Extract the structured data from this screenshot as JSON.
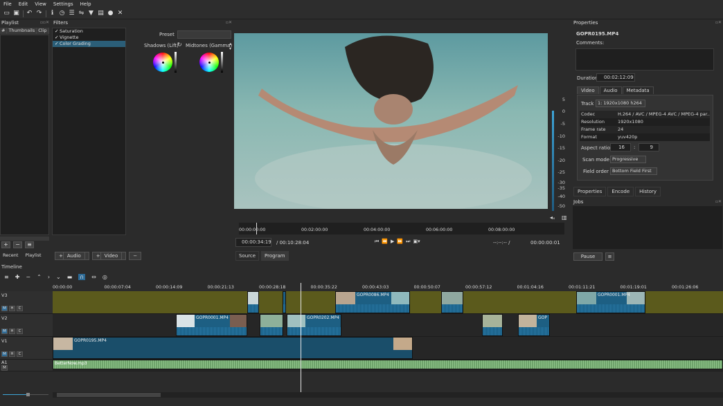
{
  "menu": [
    "File",
    "Edit",
    "View",
    "Settings",
    "Help"
  ],
  "playlist": {
    "title": "Playlist",
    "tabs": [
      "#",
      "Thumbnails",
      "Clip"
    ],
    "bottom_tabs": [
      "Recent",
      "Playlist"
    ]
  },
  "filters": {
    "title": "Filters",
    "items": [
      {
        "label": "Saturation",
        "checked": true,
        "selected": false
      },
      {
        "label": "Vignette",
        "checked": true,
        "selected": false
      },
      {
        "label": "Color Grading",
        "checked": true,
        "selected": true
      }
    ],
    "preset_label": "Preset",
    "shadows_label": "Shadows (Lift)",
    "midtones_label": "Midtones (Gamma)"
  },
  "add_buttons": {
    "audio": "Audio",
    "video": "Video"
  },
  "player": {
    "ruler_ticks": [
      "00:00:00:00",
      "00:02:00:00",
      "00:04:00:00",
      "00:06:00:00",
      "00:08:00:00"
    ],
    "current_tc": "00:00:34:19",
    "duration": "/ 00:10:28:04",
    "in_out": "--:--:-- /",
    "end_tc": "00:00:00:01",
    "tabs": [
      "Source",
      "Program"
    ],
    "vu_labels": [
      "5",
      "0",
      "-5",
      "-10",
      "-15",
      "-20",
      "-25",
      "-30",
      "-35",
      "-40",
      "-50"
    ]
  },
  "properties": {
    "title": "Properties",
    "filename": "GOPR0195.MP4",
    "comments_label": "Comments:",
    "duration_label": "Duration",
    "duration_value": "00:02:12:09",
    "tabs": [
      "Video",
      "Audio",
      "Metadata"
    ],
    "track_label": "Track",
    "track_value": "1: 1920x1080 h264",
    "info": [
      {
        "k": "Codec",
        "v": "H.264 / AVC / MPEG-4 AVC / MPEG-4 par..."
      },
      {
        "k": "Resolution",
        "v": "1920x1080"
      },
      {
        "k": "Frame rate",
        "v": "24"
      },
      {
        "k": "Format",
        "v": "yuv420p"
      }
    ],
    "aspect_label": "Aspect ratio",
    "aspect_a": "16",
    "aspect_sep": ":",
    "aspect_b": "9",
    "scan_label": "Scan mode",
    "scan_value": "Progressive",
    "field_label": "Field order",
    "field_value": "Bottom Field First",
    "bottom_tabs": [
      "Properties",
      "Encode",
      "History"
    ]
  },
  "jobs": {
    "title": "Jobs",
    "pause": "Pause"
  },
  "timeline": {
    "title": "Timeline",
    "ruler": [
      "00:00:00",
      "00:00:07:04",
      "00:00:14:09",
      "00:00:21:13",
      "00:00:28:18",
      "00:00:35:22",
      "00:00:43:03",
      "00:00:50:07",
      "00:00:57:12",
      "00:01:04:16",
      "00:01:11:21",
      "00:01:19:01",
      "00:01:26:06"
    ],
    "tracks": [
      {
        "name": "V3",
        "buttons": [
          "M",
          "H",
          "C"
        ]
      },
      {
        "name": "V2",
        "buttons": [
          "M",
          "H",
          "C"
        ]
      },
      {
        "name": "V1",
        "buttons": [
          "M",
          "H",
          "C"
        ]
      },
      {
        "name": "A1",
        "buttons": [
          "M"
        ]
      }
    ],
    "clip_labels": {
      "v3a": "GOPR0086.MP4",
      "v3b": "GOPR0001.MP4",
      "v2a": "GOPR0001.MP4",
      "v2b": "GOPR0202.MP4",
      "v2c": "GOP",
      "v1a": "GOPR0195.MP4",
      "a1": "BetterNow.mp3"
    }
  }
}
